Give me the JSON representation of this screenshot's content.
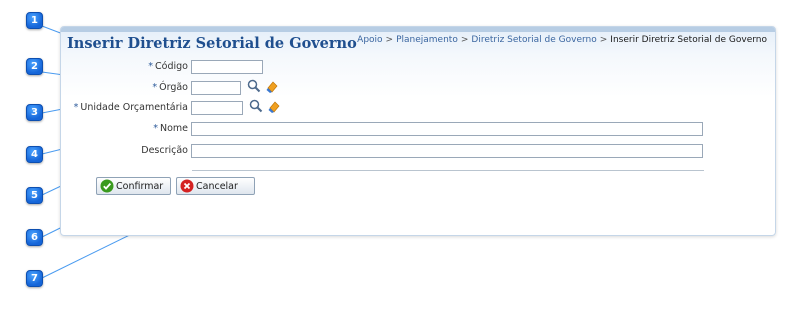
{
  "page": {
    "title": "Inserir Diretriz Setorial de Governo",
    "breadcrumb": [
      {
        "label": "Apoio",
        "link": true
      },
      {
        "label": "Planejamento",
        "link": true
      },
      {
        "label": "Diretriz Setorial de Governo",
        "link": true
      },
      {
        "label": "Inserir Diretriz Setorial de Governo",
        "link": false
      }
    ],
    "breadcrumb_separator": ">"
  },
  "form": {
    "required_mark": "*",
    "fields": {
      "codigo": {
        "label": "Código",
        "required": true,
        "value": ""
      },
      "orgao": {
        "label": "Órgão",
        "required": true,
        "value": ""
      },
      "unidade": {
        "label": "Unidade Orçamentária",
        "required": true,
        "value": ""
      },
      "nome": {
        "label": "Nome",
        "required": true,
        "value": ""
      },
      "descricao": {
        "label": "Descrição",
        "required": false,
        "value": ""
      }
    },
    "icons": {
      "lookup": "search-icon",
      "clear": "eraser-icon"
    }
  },
  "buttons": {
    "confirmar": {
      "label": "Confirmar",
      "icon": "check-icon",
      "color": "#3a9a1e"
    },
    "cancelar": {
      "label": "Cancelar",
      "icon": "cancel-icon",
      "color": "#d42222"
    }
  },
  "callouts": [
    "1",
    "2",
    "3",
    "4",
    "5",
    "6",
    "7"
  ],
  "colors": {
    "accent": "#1f4f8f",
    "callout": "#1565d8",
    "panel_border": "#c5d6e8"
  }
}
